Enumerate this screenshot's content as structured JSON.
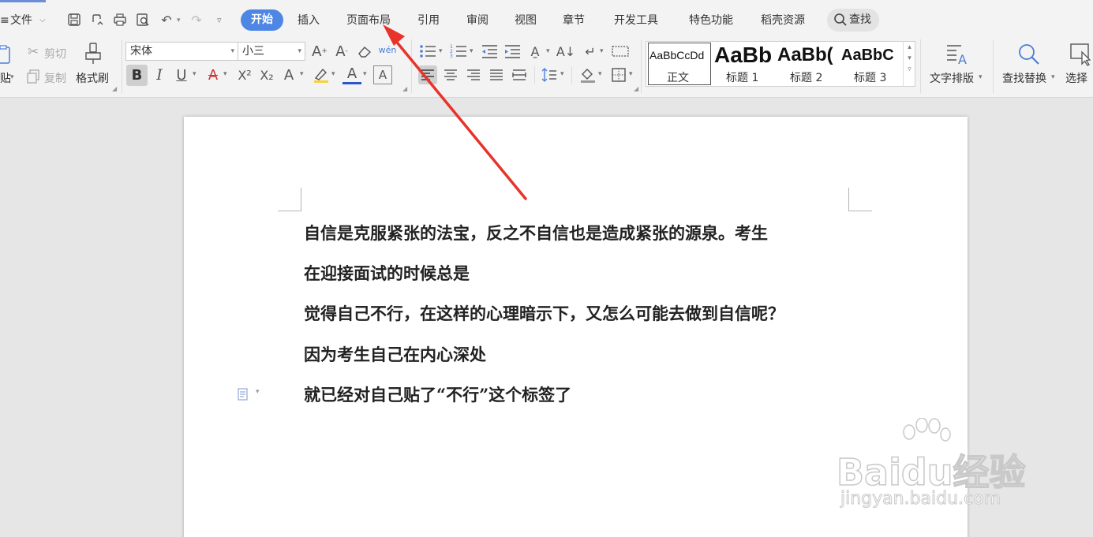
{
  "menubar": {
    "file_label": "文件",
    "tabs": [
      "开始",
      "插入",
      "页面布局",
      "引用",
      "审阅",
      "视图",
      "章节",
      "开发工具",
      "特色功能",
      "稻壳资源"
    ],
    "active_tab": "开始",
    "search_label": "查找",
    "accent_color": "#4e86e4"
  },
  "ribbon": {
    "clipboard": {
      "paste_label": "贴",
      "cut_label": "剪切",
      "copy_label": "复制",
      "format_painter_label": "格式刷"
    },
    "font": {
      "font_name": "宋体",
      "font_size": "小三"
    },
    "styles": {
      "items": [
        {
          "sample": "AaBbCcDd",
          "label": "正文"
        },
        {
          "sample": "AaBb",
          "label": "标题 1"
        },
        {
          "sample": "AaBb(",
          "label": "标题 2"
        },
        {
          "sample": "AaBbC",
          "label": "标题 3"
        }
      ],
      "selected": "正文"
    },
    "text_layout_label": "文字排版",
    "find_replace_label": "查找替换",
    "select_label": "选择"
  },
  "document": {
    "lines": [
      "自信是克服紧张的法宝，反之不自信也是造成紧张的源泉。考生",
      "在迎接面试的时候总是",
      "觉得自己不行，在这样的心理暗示下，又怎么可能去做到自信呢？",
      "因为考生自己在内心深处",
      "就已经对自己贴了“不行”这个标签了"
    ]
  },
  "watermark": {
    "brand": "Baidu经验",
    "url": "jingyan.baidu.com"
  },
  "annotation": {
    "arrow_color": "#e8332b"
  }
}
